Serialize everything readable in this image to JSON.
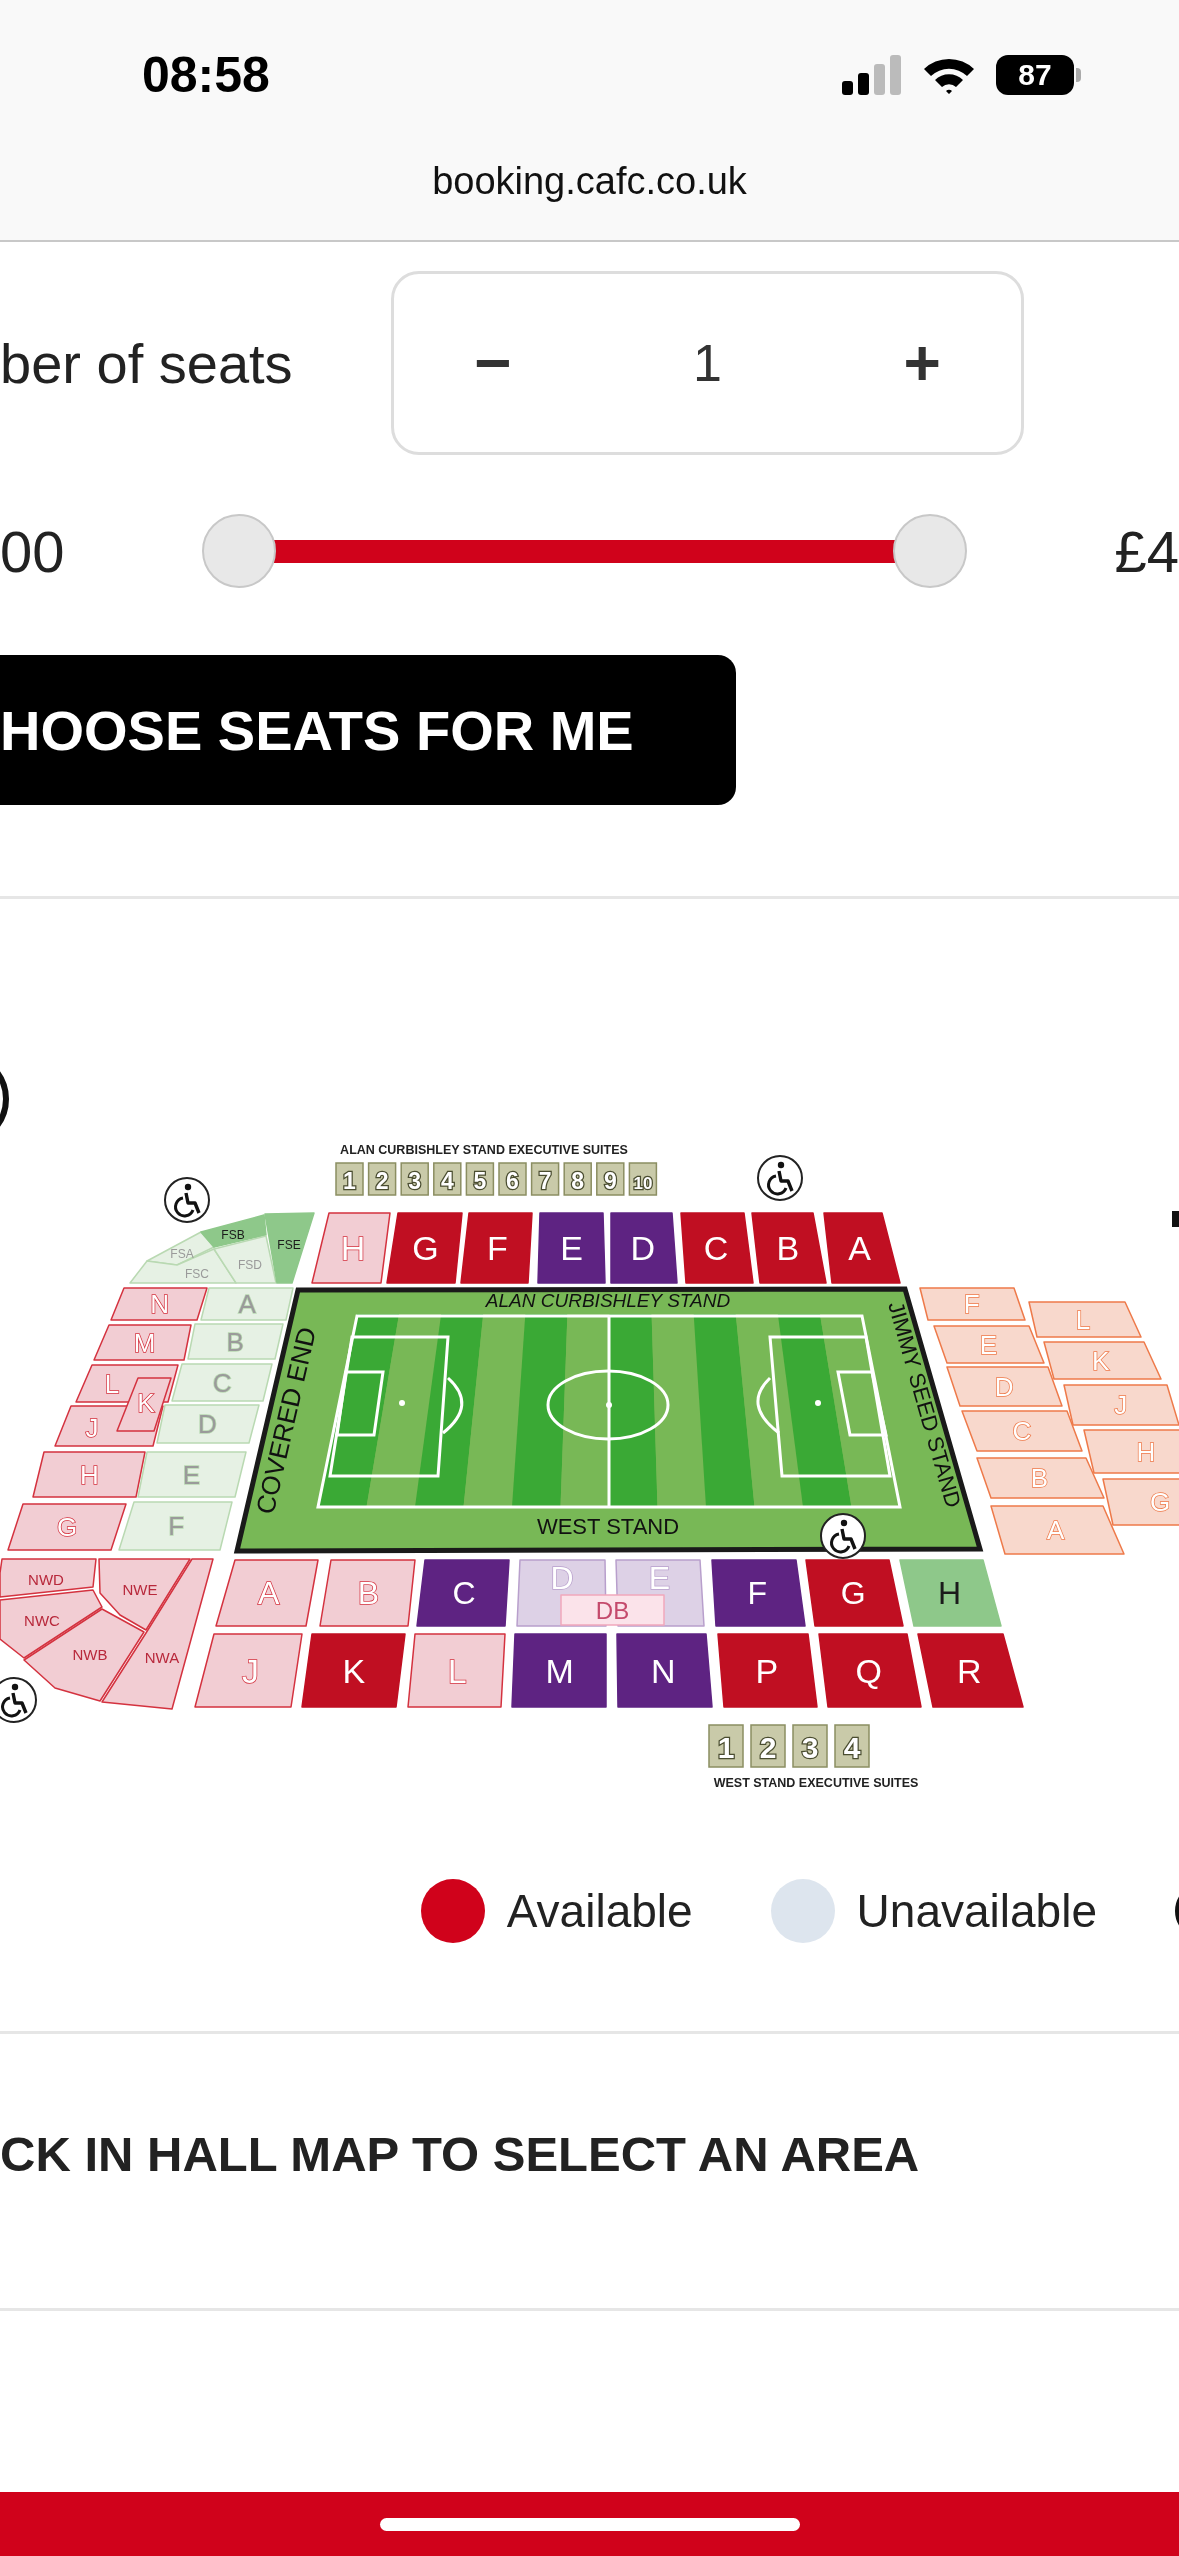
{
  "status_bar": {
    "time": "08:58",
    "battery": "87"
  },
  "address_bar": {
    "url": "booking.cafc.co.uk"
  },
  "seat_count": {
    "label": "ber of seats",
    "decrement": "−",
    "value": "1",
    "increment": "+"
  },
  "price_filter": {
    "min_label": "00",
    "max_label": "£4",
    "handles": [
      {
        "level": 0
      },
      {
        "level": 1
      }
    ]
  },
  "choose_button": {
    "label": "HOOSE SEATS FOR ME"
  },
  "stadium_map": {
    "suites_top": {
      "title": "ALAN CURBISHLEY STAND EXECUTIVE SUITES",
      "suites": [
        "1",
        "2",
        "3",
        "4",
        "5",
        "6",
        "7",
        "8",
        "9",
        "10"
      ]
    },
    "block_groups": [
      {
        "blocks": [
          {
            "label": "FSA",
            "color": "#e6f1e4"
          },
          {
            "label": "FSB",
            "color": "#8ec88a"
          },
          {
            "label": "FSC",
            "color": "#e6f1e4"
          },
          {
            "label": "FSD",
            "color": "#e6f1e4"
          },
          {
            "label": "FSE",
            "color": "#8ec88a"
          }
        ]
      },
      {
        "blocks": [
          {
            "label": "H",
            "color": "#f2cdd3"
          },
          {
            "label": "G",
            "color": "#c00f22"
          },
          {
            "label": "F",
            "color": "#c00f22"
          },
          {
            "label": "E",
            "color": "#5e2382"
          },
          {
            "label": "D",
            "color": "#5e2382"
          },
          {
            "label": "C",
            "color": "#c00f22"
          },
          {
            "label": "B",
            "color": "#c00f22"
          },
          {
            "label": "A",
            "color": "#c00f22"
          }
        ]
      },
      {
        "blocks": [
          {
            "label": "N",
            "color": "#f2cdd3"
          },
          {
            "label": "M",
            "color": "#f2cdd3"
          },
          {
            "label": "L",
            "color": "#f2cdd3"
          },
          {
            "label": "K",
            "color": "#f2cdd3"
          },
          {
            "label": "J",
            "color": "#f2cdd3"
          },
          {
            "label": "H",
            "color": "#f2cdd3"
          },
          {
            "label": "G",
            "color": "#f2cdd3"
          }
        ]
      },
      {
        "blocks": [
          {
            "label": "A",
            "color": "#e6f1e4"
          },
          {
            "label": "B",
            "color": "#e6f1e4"
          },
          {
            "label": "C",
            "color": "#e6f1e4"
          },
          {
            "label": "D",
            "color": "#e6f1e4"
          },
          {
            "label": "E",
            "color": "#e6f1e4"
          },
          {
            "label": "F",
            "color": "#e6f1e4"
          }
        ]
      },
      {
        "blocks": [
          {
            "label": "F",
            "color": "#f8d8cc"
          },
          {
            "label": "E",
            "color": "#f8d8cc"
          },
          {
            "label": "D",
            "color": "#f8d8cc"
          },
          {
            "label": "C",
            "color": "#f8d8cc"
          },
          {
            "label": "B",
            "color": "#f8d8cc"
          },
          {
            "label": "A",
            "color": "#f8d8cc"
          }
        ]
      },
      {
        "blocks": [
          {
            "label": "L",
            "color": "#f8d8cc"
          },
          {
            "label": "K",
            "color": "#f8d8cc"
          },
          {
            "label": "J",
            "color": "#f8d8cc"
          },
          {
            "label": "H",
            "color": "#f8d8cc"
          },
          {
            "label": "G",
            "color": "#f8d8cc"
          }
        ]
      },
      {
        "blocks": [
          {
            "label": "NWD",
            "color": "#f2cdd3"
          },
          {
            "label": "NWE",
            "color": "#f2cdd3"
          },
          {
            "label": "NWC",
            "color": "#f2cdd3"
          },
          {
            "label": "NWB",
            "color": "#f2cdd3"
          },
          {
            "label": "NWA",
            "color": "#f2cdd3"
          }
        ]
      },
      {
        "blocks": [
          {
            "label": "A",
            "color": "#f2cdd3"
          },
          {
            "label": "B",
            "color": "#f2cdd3"
          },
          {
            "label": "C",
            "color": "#5e2382"
          },
          {
            "label": "D",
            "color": "#ddd1e6"
          },
          {
            "label": "E",
            "color": "#ddd1e6"
          },
          {
            "label": "DB",
            "color": "#fbe3ea"
          },
          {
            "label": "F",
            "color": "#5e2382"
          },
          {
            "label": "G",
            "color": "#c00f22"
          },
          {
            "label": "H",
            "color": "#8ec88a"
          }
        ]
      },
      {
        "blocks": [
          {
            "label": "J",
            "color": "#f2cdd3"
          },
          {
            "label": "K",
            "color": "#c00f22"
          },
          {
            "label": "L",
            "color": "#f2cdd3"
          },
          {
            "label": "M",
            "color": "#5e2382"
          },
          {
            "label": "N",
            "color": "#5e2382"
          },
          {
            "label": "P",
            "color": "#c00f22"
          },
          {
            "label": "Q",
            "color": "#c00f22"
          },
          {
            "label": "R",
            "color": "#c00f22"
          }
        ]
      }
    ],
    "pitch_labels": [
      "ALAN CURBISHLEY STAND",
      "COVERED END",
      "JIMMY SEED STAND",
      "WEST STAND"
    ],
    "suites_bottom": {
      "title": "WEST STAND EXECUTIVE SUITES",
      "suites": [
        "1",
        "2",
        "3",
        "4"
      ]
    }
  },
  "legend": [
    {
      "label": "Available",
      "color": "#d0021b"
    },
    {
      "label": "Unavailable",
      "color": "#dde5ee"
    }
  ],
  "instruction": "CK IN HALL MAP TO SELECT AN AREA"
}
